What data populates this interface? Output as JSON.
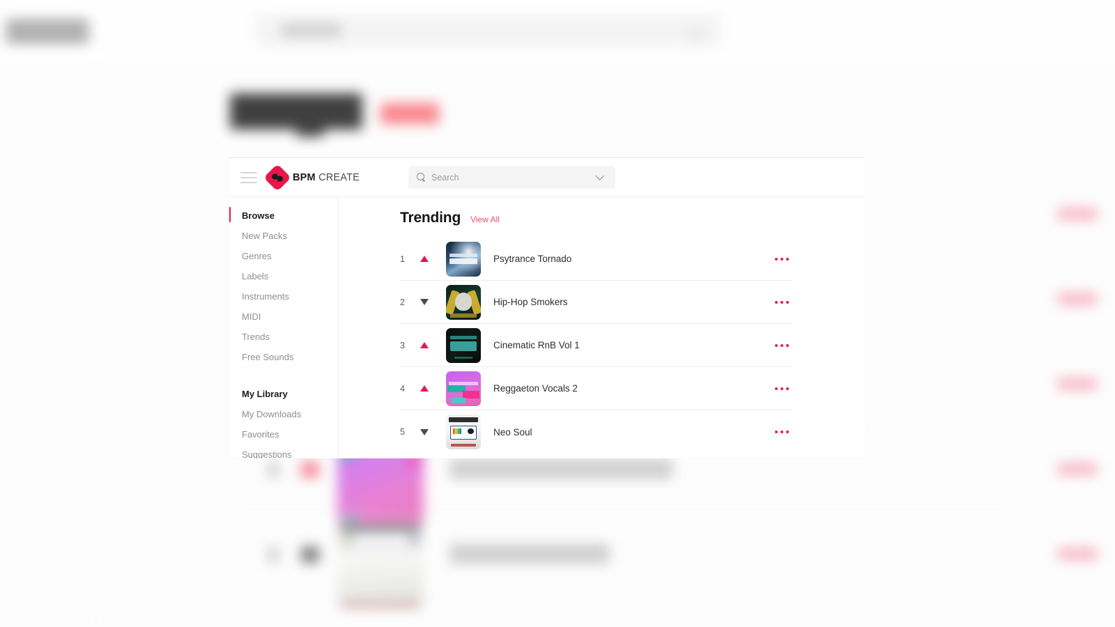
{
  "app": {
    "brand_bold": "BPM",
    "brand_light": "CREATE",
    "accent": "#e8174a",
    "link_color": "#ef4f68"
  },
  "header": {
    "menu_label": "Menu",
    "logo_name": "BPM CREATE"
  },
  "search": {
    "placeholder": "Search",
    "value": "",
    "icon": "search-icon",
    "dropdown_icon": "chevron-down-icon"
  },
  "sidebar": {
    "browse_group": [
      {
        "label": "Browse",
        "active": true,
        "heading": true
      },
      {
        "label": "New Packs",
        "active": false,
        "heading": false
      },
      {
        "label": "Genres",
        "active": false,
        "heading": false
      },
      {
        "label": "Labels",
        "active": false,
        "heading": false
      },
      {
        "label": "Instruments",
        "active": false,
        "heading": false
      },
      {
        "label": "MIDI",
        "active": false,
        "heading": false
      },
      {
        "label": "Trends",
        "active": false,
        "heading": false
      },
      {
        "label": "Free Sounds",
        "active": false,
        "heading": false
      }
    ],
    "library_group": [
      {
        "label": "My Library",
        "active": false,
        "heading": true
      },
      {
        "label": "My Downloads",
        "active": false,
        "heading": false
      },
      {
        "label": "Favorites",
        "active": false,
        "heading": false
      },
      {
        "label": "Suggestions",
        "active": false,
        "heading": false
      }
    ]
  },
  "main": {
    "section_title": "Trending",
    "view_all_label": "View All",
    "rows": [
      {
        "rank": "1",
        "trend": "up",
        "title": "Psytrance Tornado",
        "art": "art-psy",
        "more_icon": "more-options-icon"
      },
      {
        "rank": "2",
        "trend": "down",
        "title": "Hip-Hop Smokers",
        "art": "art-hip",
        "more_icon": "more-options-icon"
      },
      {
        "rank": "3",
        "trend": "up",
        "title": "Cinematic RnB Vol 1",
        "art": "art-cin",
        "more_icon": "more-options-icon"
      },
      {
        "rank": "4",
        "trend": "up",
        "title": "Reggaeton Vocals 2",
        "art": "art-reg",
        "more_icon": "more-options-icon"
      },
      {
        "rank": "5",
        "trend": "down",
        "title": "Neo Soul",
        "art": "art-neo",
        "more_icon": "more-options-icon"
      }
    ]
  }
}
